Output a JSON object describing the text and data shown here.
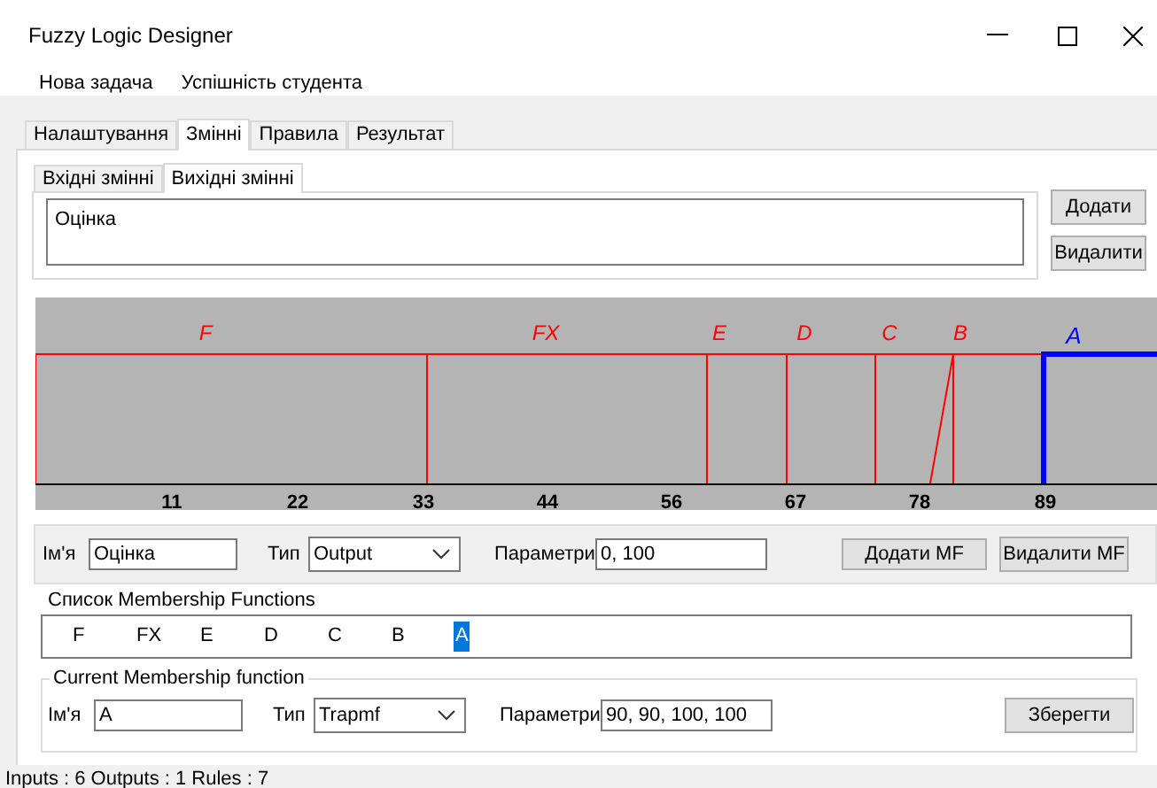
{
  "window": {
    "title": "Fuzzy Logic Designer"
  },
  "menu": [
    "Нова задача",
    "Успішність студента"
  ],
  "tabs": [
    {
      "label": "Налаштування",
      "selected": false
    },
    {
      "label": "Змінні",
      "selected": true
    },
    {
      "label": "Правила",
      "selected": false
    },
    {
      "label": "Результат",
      "selected": false
    }
  ],
  "subtabs": [
    {
      "label": "Вхідні змінні",
      "selected": false
    },
    {
      "label": "Вихідні змінні",
      "selected": true
    }
  ],
  "variables": {
    "items": [
      "Оцінка"
    ],
    "buttons": [
      "Додати",
      "Видалити"
    ]
  },
  "plot": {
    "curves": [
      {
        "label": "F",
        "selected": false
      },
      {
        "label": "FX",
        "selected": false
      },
      {
        "label": "E",
        "selected": false
      },
      {
        "label": "D",
        "selected": false
      },
      {
        "label": "C",
        "selected": false
      },
      {
        "label": "B",
        "selected": false
      },
      {
        "label": "A",
        "selected": true
      }
    ],
    "ticks": [
      "11",
      "22",
      "33",
      "44",
      "56",
      "67",
      "78",
      "89"
    ]
  },
  "variable_form": {
    "name_label": "Ім'я",
    "name_value": "Оцінка",
    "type_label": "Тип",
    "type_value": "Output",
    "params_label": "Параметри",
    "params_value": "0, 100",
    "buttons": [
      "Додати MF",
      "Видалити MF"
    ]
  },
  "mf_list": {
    "title": "Список Membership Functions",
    "items": [
      {
        "label": "F",
        "selected": false
      },
      {
        "label": "FX",
        "selected": false
      },
      {
        "label": "E",
        "selected": false
      },
      {
        "label": "D",
        "selected": false
      },
      {
        "label": "C",
        "selected": false
      },
      {
        "label": "B",
        "selected": false
      },
      {
        "label": "A",
        "selected": true
      }
    ]
  },
  "current_mf": {
    "title": "Current Membership function",
    "name_label": "Ім'я",
    "name_value": "A",
    "type_label": "Тип",
    "type_value": "Trapmf",
    "params_label": "Параметри",
    "params_value": "90, 90, 100, 100",
    "button": "Зберегти"
  },
  "status_bar": "Inputs : 6  Outputs : 1  Rules : 7"
}
